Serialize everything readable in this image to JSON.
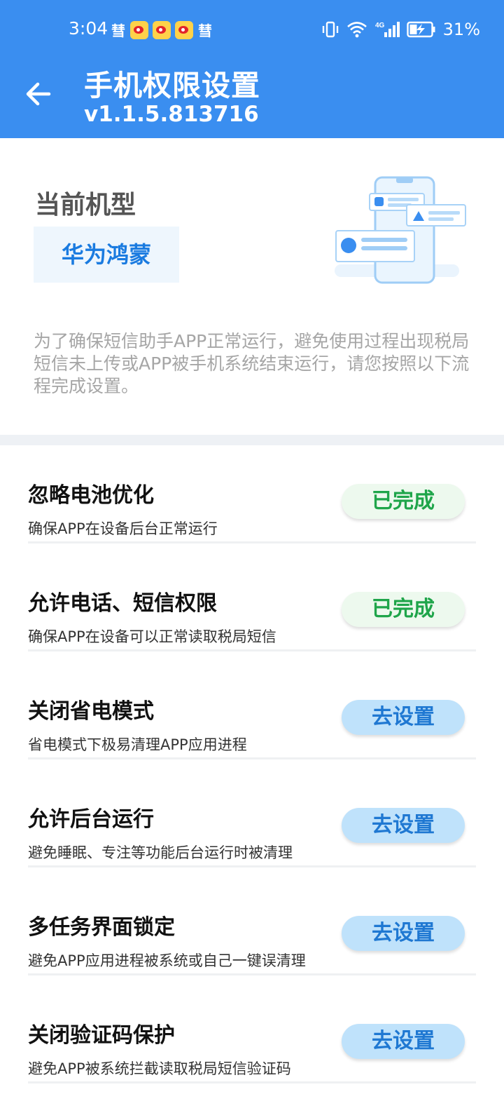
{
  "status_bar": {
    "time": "3:04",
    "notification_icons": [
      "hui-icon",
      "weibo-icon",
      "weibo-icon",
      "weibo-icon",
      "hui-icon"
    ],
    "hui_glyph": "彗",
    "network_label": "4G",
    "battery_percent": "31%"
  },
  "header": {
    "title": "手机权限设置",
    "version": "v1.1.5.813716",
    "back_icon": "arrow-left-icon"
  },
  "device": {
    "label": "当前机型",
    "value": "华为鸿蒙",
    "intro": "为了确保短信助手APP正常运行，避免使用过程出现税局短信未上传或APP被手机系统结束运行，请您按照以下流程完成设置。"
  },
  "settings": [
    {
      "title": "忽略电池优化",
      "description": "确保APP在设备后台正常运行",
      "action_label": "已完成",
      "status": "done"
    },
    {
      "title": "允许电话、短信权限",
      "description": "确保APP在设备可以正常读取税局短信",
      "action_label": "已完成",
      "status": "done"
    },
    {
      "title": "关闭省电模式",
      "description": "省电模式下极易清理APP应用进程",
      "action_label": "去设置",
      "status": "pending"
    },
    {
      "title": "允许后台运行",
      "description": "避免睡眠、专注等功能后台运行时被清理",
      "action_label": "去设置",
      "status": "pending"
    },
    {
      "title": "多任务界面锁定",
      "description": "避免APP应用进程被系统或自己一键误清理",
      "action_label": "去设置",
      "status": "pending"
    },
    {
      "title": "关闭验证码保护",
      "description": "避免APP被系统拦截读取税局短信验证码",
      "action_label": "去设置",
      "status": "pending"
    }
  ],
  "colors": {
    "header_bg": "#3a8ef0",
    "done_text": "#1fa54a",
    "done_bg": "#edf9ee",
    "goto_text": "#1f78d2",
    "goto_bg": "#bfe2fb"
  }
}
